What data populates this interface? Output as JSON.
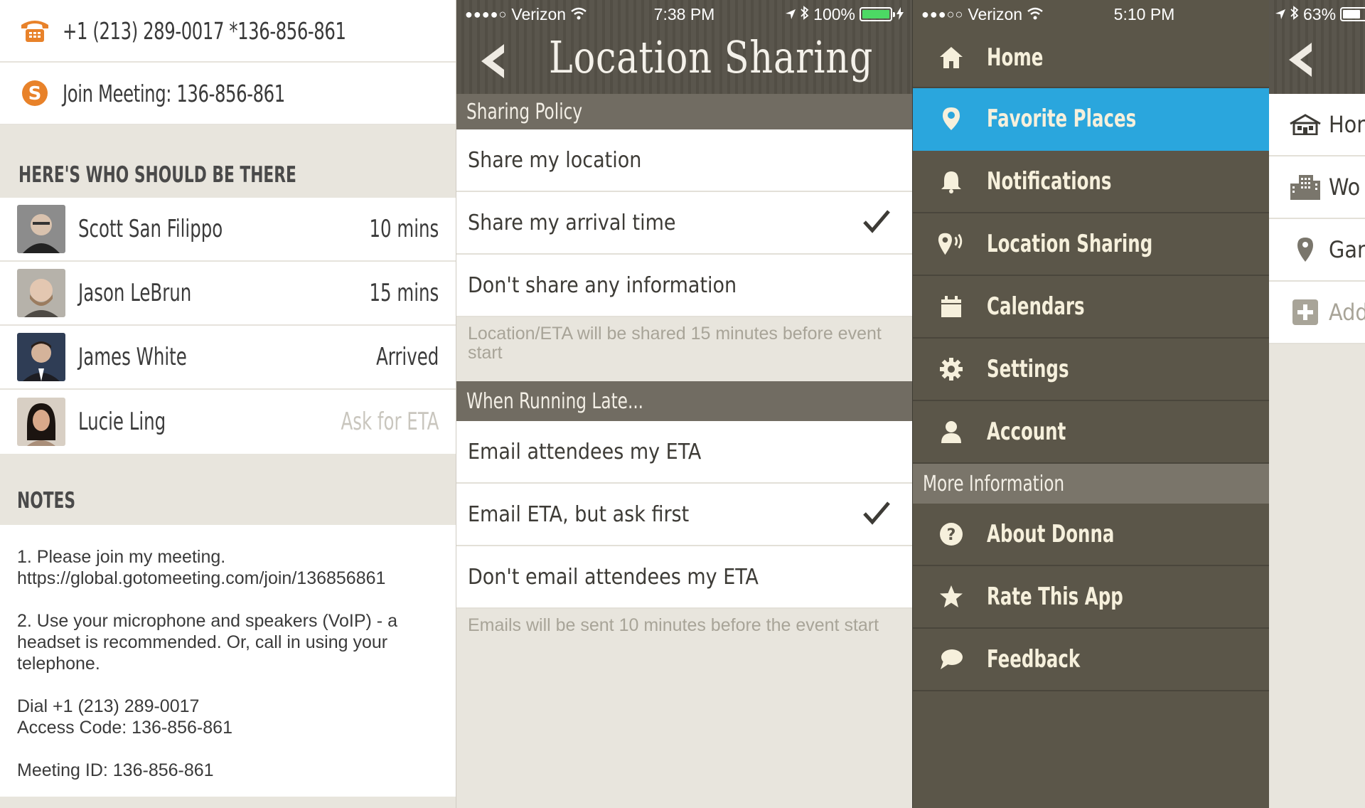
{
  "meeting": {
    "phone": "+1 (213) 289-0017  *136-856-861",
    "join": "Join Meeting: 136-856-861",
    "attendees_header": "HERE'S WHO SHOULD BE THERE",
    "attendees": [
      {
        "name": "Scott San Filippo",
        "eta": "10 mins",
        "muted": false
      },
      {
        "name": "Jason LeBrun",
        "eta": "15 mins",
        "muted": false
      },
      {
        "name": "James White",
        "eta": "Arrived",
        "muted": false
      },
      {
        "name": "Lucie Ling",
        "eta": "Ask for ETA",
        "muted": true
      }
    ],
    "notes_header": "NOTES",
    "notes": [
      "1.  Please join my meeting.\nhttps://global.gotomeeting.com/join/136856861",
      "2.  Use your microphone and speakers (VoIP) - a\nheadset is recommended. Or, call in using your\ntelephone.",
      "Dial +1 (213) 289-0017\nAccess Code: 136-856-861",
      "Meeting ID: 136-856-861"
    ]
  },
  "location": {
    "status": {
      "dots": "●●●●○",
      "carrier": "Verizon",
      "time": "7:38 PM",
      "battery": "100%",
      "battery_level": 1.0
    },
    "title": "Location Sharing",
    "sharing_policy_header": "Sharing Policy",
    "sharing_options": [
      {
        "label": "Share my location",
        "checked": false
      },
      {
        "label": "Share my arrival time",
        "checked": true
      },
      {
        "label": "Don't share any information",
        "checked": false
      }
    ],
    "sharing_note": "Location/ETA will be shared 15 minutes before event start",
    "late_header": "When Running Late...",
    "late_options": [
      {
        "label": "Email attendees my ETA",
        "checked": false
      },
      {
        "label": "Email ETA, but ask first",
        "checked": true
      },
      {
        "label": "Don't email attendees my ETA",
        "checked": false
      }
    ],
    "late_note": "Emails will be sent 10 minutes before the event start"
  },
  "menu": {
    "status": {
      "dots": "●●●○○",
      "carrier": "Verizon",
      "time": "5:10 PM",
      "battery": "63%",
      "battery_level": 0.63
    },
    "items": [
      {
        "label": "Home",
        "icon": "home-icon"
      },
      {
        "label": "Favorite Places",
        "icon": "pin-icon",
        "active": true
      },
      {
        "label": "Notifications",
        "icon": "bell-icon"
      },
      {
        "label": "Location Sharing",
        "icon": "location-broadcast-icon"
      },
      {
        "label": "Calendars",
        "icon": "calendar-icon"
      },
      {
        "label": "Settings",
        "icon": "gear-icon"
      },
      {
        "label": "Account",
        "icon": "person-icon"
      }
    ],
    "more_header": "More Information",
    "more_items": [
      {
        "label": "About Donna",
        "icon": "question-icon"
      },
      {
        "label": "Rate This App",
        "icon": "star-icon"
      },
      {
        "label": "Feedback",
        "icon": "speech-bubble-icon"
      }
    ]
  },
  "places": {
    "rows": [
      {
        "label": "Hor",
        "icon": "house-icon"
      },
      {
        "label": "Wo",
        "icon": "office-building-icon"
      },
      {
        "label": "Gar",
        "icon": "pin-icon"
      },
      {
        "label": "Add",
        "icon": "plus-box-icon",
        "muted": true
      }
    ]
  },
  "colors": {
    "accent": "#2aa6dd",
    "menu_bg": "#5b5649",
    "section_bg": "#716c62",
    "cream": "#e8e5dd",
    "phone_icon": "#e8822a"
  }
}
